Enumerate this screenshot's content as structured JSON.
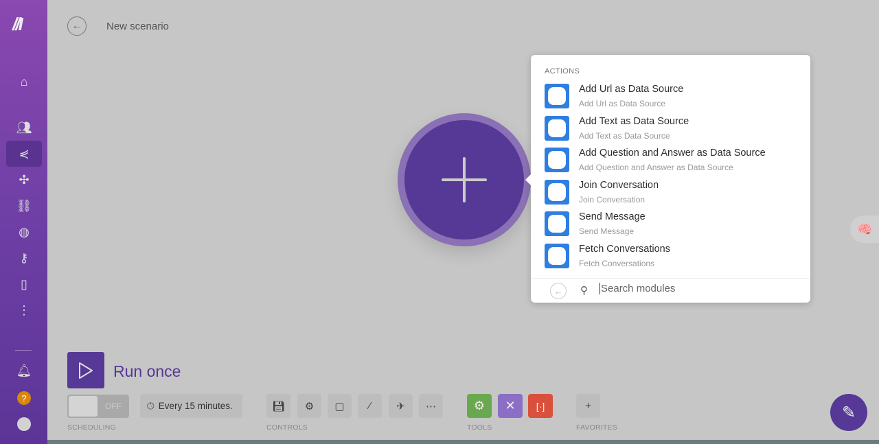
{
  "header": {
    "title": "New scenario"
  },
  "popup": {
    "section": "ACTIONS",
    "modules": [
      {
        "name": "Add Url as Data Source",
        "sub": "Add Url as Data Source"
      },
      {
        "name": "Add Text as Data Source",
        "sub": "Add Text as Data Source"
      },
      {
        "name": "Add Question and Answer as Data Source",
        "sub": "Add Question and Answer as Data Source"
      },
      {
        "name": "Join Conversation",
        "sub": "Join Conversation"
      },
      {
        "name": "Send Message",
        "sub": "Send Message"
      },
      {
        "name": "Fetch Conversations",
        "sub": "Fetch Conversations"
      }
    ],
    "search_placeholder": "Search modules"
  },
  "toolbar": {
    "run_label": "Run once",
    "toggle": "OFF",
    "schedule": "Every 15 minutes.",
    "labels": {
      "scheduling": "SCHEDULING",
      "controls": "CONTROLS",
      "tools": "TOOLS",
      "favorites": "FAVORITES"
    }
  },
  "colors": {
    "brand": "#563896",
    "module": "#2f7ee0",
    "tool_green": "#6aa84f",
    "tool_purple": "#8b6fc4",
    "tool_red": "#d9503c"
  }
}
